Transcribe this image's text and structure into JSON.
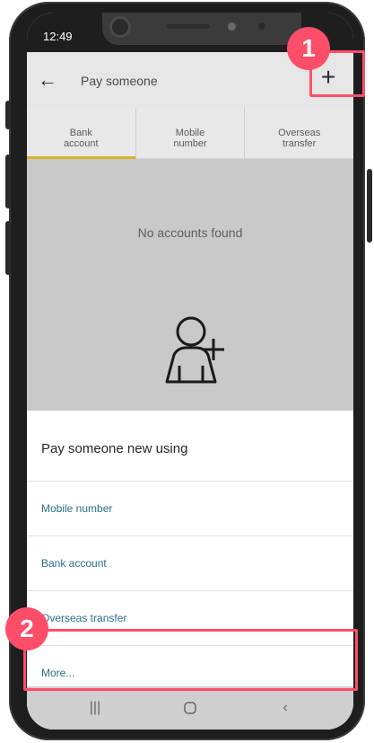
{
  "status_bar": {
    "time": "12:49"
  },
  "header": {
    "title": "Pay someone",
    "back_icon": "arrow-left-icon",
    "add_icon": "plus-icon"
  },
  "tabs": [
    {
      "label": "Bank\naccount",
      "active": true
    },
    {
      "label": "Mobile\nnumber",
      "active": false
    },
    {
      "label": "Overseas\ntransfer",
      "active": false
    }
  ],
  "empty_state": {
    "text": "No accounts found",
    "icon": "add-person-icon"
  },
  "sheet": {
    "title": "Pay someone new using",
    "items": [
      {
        "label": "Mobile number"
      },
      {
        "label": "Bank account"
      },
      {
        "label": "Overseas transfer"
      },
      {
        "label": "More..."
      }
    ]
  },
  "callouts": [
    {
      "number": "1"
    },
    {
      "number": "2"
    }
  ],
  "colors": {
    "accent": "#d6b32a",
    "callout": "#ff4e6a",
    "link": "#2b6f8f"
  }
}
